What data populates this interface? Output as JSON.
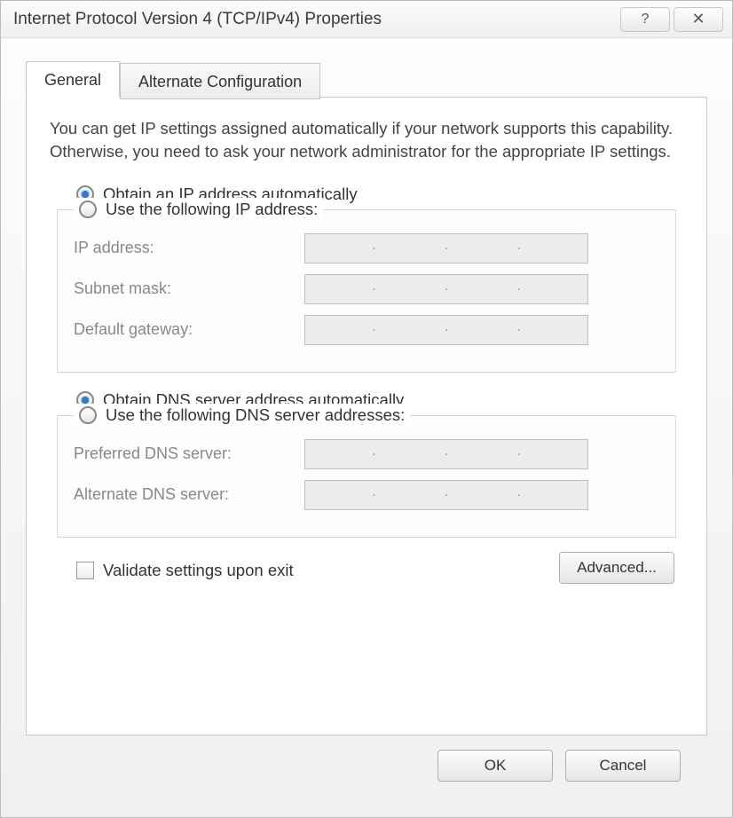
{
  "window": {
    "title": "Internet Protocol Version 4 (TCP/IPv4) Properties",
    "help_symbol": "?",
    "close_symbol": "✕"
  },
  "tabs": {
    "general": "General",
    "alternate": "Alternate Configuration"
  },
  "description": "You can get IP settings assigned automatically if your network supports this capability. Otherwise, you need to ask your network administrator for the appropriate IP settings.",
  "ip_section": {
    "auto": "Obtain an IP address automatically",
    "manual": "Use the following IP address:",
    "fields": {
      "ip": "IP address:",
      "subnet": "Subnet mask:",
      "gateway": "Default gateway:"
    },
    "selected": "auto"
  },
  "dns_section": {
    "auto": "Obtain DNS server address automatically",
    "manual": "Use the following DNS server addresses:",
    "fields": {
      "preferred": "Preferred DNS server:",
      "alternate": "Alternate DNS server:"
    },
    "selected": "auto"
  },
  "validate": {
    "label": "Validate settings upon exit",
    "checked": false
  },
  "buttons": {
    "advanced": "Advanced...",
    "ok": "OK",
    "cancel": "Cancel"
  }
}
